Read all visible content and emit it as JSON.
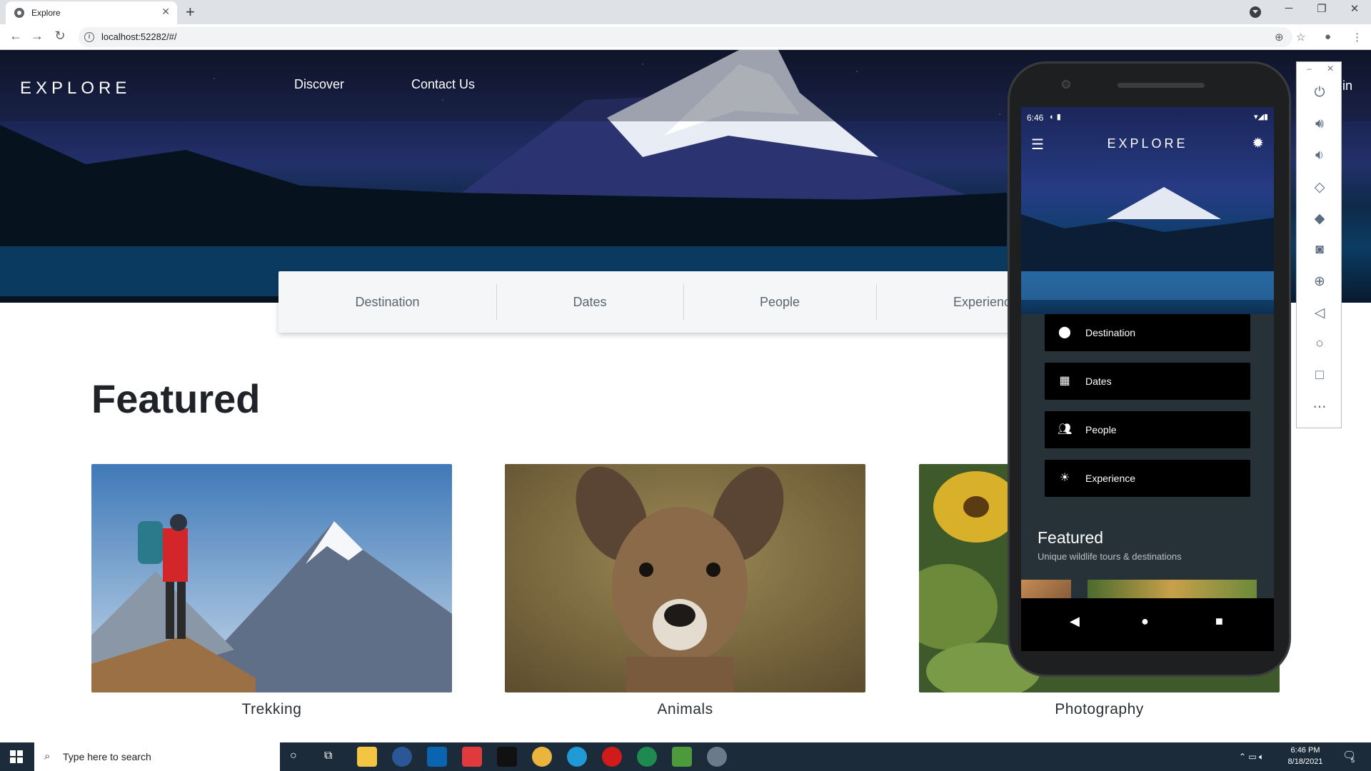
{
  "browser": {
    "tab_title": "Explore",
    "tab_close": "✕",
    "new_tab": "+",
    "url": "localhost:52282/#/",
    "window_controls": {
      "minimize": "─",
      "restore": "❐",
      "close": "✕"
    }
  },
  "site": {
    "brand": "EXPLORE",
    "nav": {
      "discover": "Discover",
      "contact": "Contact Us",
      "partial_right": "in"
    },
    "search_fields": [
      "Destination",
      "Dates",
      "People",
      "Experience"
    ],
    "featured_heading": "Featured",
    "cards": [
      {
        "caption": "Trekking"
      },
      {
        "caption": "Animals"
      },
      {
        "caption": "Photography"
      }
    ]
  },
  "emulator": {
    "status_time": "6:46",
    "brand": "EXPLORE",
    "buttons": [
      {
        "label": "Destination",
        "icon": "location-pin-icon"
      },
      {
        "label": "Dates",
        "icon": "calendar-icon"
      },
      {
        "label": "People",
        "icon": "people-icon"
      },
      {
        "label": "Experience",
        "icon": "sun-icon"
      }
    ],
    "featured_title": "Featured",
    "featured_subtitle": "Unique wildlife tours & destinations",
    "tools_close": "✕",
    "tools_minimize": "–"
  },
  "taskbar": {
    "search_placeholder": "Type here to search",
    "time": "6:46 PM",
    "date": "8/18/2021",
    "notification_count": "5"
  }
}
